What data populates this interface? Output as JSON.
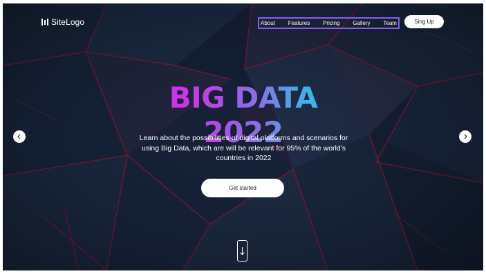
{
  "header": {
    "logo_text": "SiteLogo",
    "nav": [
      "About",
      "Features",
      "Pricing",
      "Gallery",
      "Team"
    ],
    "signup_label": "Sing Up"
  },
  "hero": {
    "title": "BIG DATA 2022",
    "description": "Learn about the possibilities of digital platforms and scenarios for using Big Data, which are will be relevant for 95% of the world's countries in 2022",
    "cta_label": "Get started"
  },
  "icons": {
    "logo": "logo-bars-icon",
    "prev": "chevron-left-icon",
    "next": "chevron-right-icon",
    "scroll": "arrow-down-icon"
  },
  "colors": {
    "background": "#131c2c",
    "accent_nav_outline": "#8a5cf6",
    "title_gradient_start": "#e51ce8",
    "title_gradient_end": "#2cc7ea",
    "edge_glow": "#d0163a"
  }
}
